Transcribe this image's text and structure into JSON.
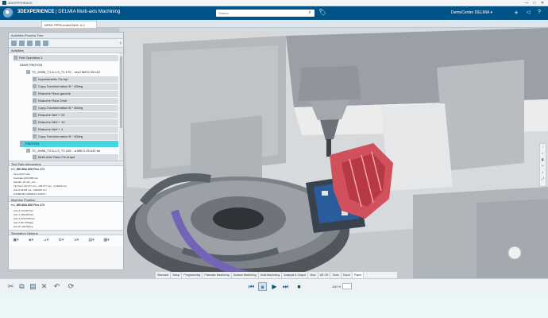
{
  "os_bar": {
    "title": "3DEXPERIENCE",
    "minimize": "—",
    "maximize": "□",
    "close": "✕"
  },
  "header": {
    "brand_bold": "3DEXPERIENCE",
    "brand_rest": " | DELMIA  Multi-axis Machining",
    "search_placeholder": "Search",
    "user": "DemoCenter DELMIA ▾",
    "icons": [
      "plus-icon",
      "share-icon",
      "share-icon",
      "help-icon"
    ]
  },
  "tabs": {
    "active": "NPKE PPRContext Ishb .A.1"
  },
  "panel": {
    "title": "Activities Process Tree",
    "tree_header": "Activities",
    "rows": [
      {
        "label": "Part Operation.1",
        "kind": "op"
      },
      {
        "label": "DEMI FINITION",
        "kind": "plain"
      },
      {
        "label": "TC_KMW_T1 A-1 0_T1 170... mod Mill D 25 b10",
        "kind": "plain"
      },
      {
        "label": "Isoparametric Fin top",
        "kind": "op"
      },
      {
        "label": "Copy-Transformation B * 40deg",
        "kind": "op"
      },
      {
        "label": "Ebauche Flanc gauche",
        "kind": "op"
      },
      {
        "label": "Ebauche Flanc Droit",
        "kind": "op"
      },
      {
        "label": "Copy-Transformation B * 40deg",
        "kind": "op"
      },
      {
        "label": "Ebauche Nerf + 20",
        "kind": "op"
      },
      {
        "label": "Ebauche Nerf + 10",
        "kind": "op"
      },
      {
        "label": "Ebauche Nerf + 1",
        "kind": "op"
      },
      {
        "label": "Copy-Transformation B * 40deg",
        "kind": "op"
      },
      {
        "label": "FINITION",
        "kind": "sel"
      },
      {
        "label": "TC_KMW_T2 A-1 0_T2 169... a Mill D 25 b10 fm",
        "kind": "plain"
      },
      {
        "label": "Multi-Axis Flank Fin drapé",
        "kind": "op"
      }
    ],
    "tool_path_title": "Tool Path Information",
    "tool_path_name": "▾ 1_DELMIA 8X8 Flex 173",
    "tool_path_lines": [
      "Time  00:07:21s",
      "Feedrate  1000.000 mm",
      "Spindle  -20 turn_mm",
      "Tip Point  -20.277 mm, -105.277 mm, -9.29322 mm",
      "Axis  0.04345 ma, -0.80345 mm",
      "  0.0085396 0.980403 0.128727"
    ],
    "machine_title": "Machine Position",
    "machine_name": "▾ 1_DELMIA 8X8 Flex 173",
    "machine_lines": [
      "Axis Z  372.967mm",
      "Axis Y  182.814mm",
      "Axis X  379.8706mm",
      "Axis A  90.7079deg",
      "Axis B  -320.91deg"
    ],
    "sim_title": "Simulation Options",
    "sim_icons": [
      "video-icon",
      "layers-icon",
      "filter-icon",
      "settings-icon",
      "measure-icon",
      "grid-icon",
      "display-icon"
    ]
  },
  "workbench_tabs": [
    "Standard",
    "Setup",
    "Programming",
    "Prismatic Machining",
    "Surface Machining",
    "Axial Machining",
    "Analysis & Output",
    "View",
    "AR-VR",
    "Tools",
    "Touch",
    "Paper"
  ],
  "workbench_active": "Paper",
  "actions": {
    "playback": [
      "⏮",
      "⏸",
      "▶",
      "⏭",
      "⏹"
    ],
    "speed_label": "100 %"
  },
  "colors": {
    "brand": "#005386",
    "selection": "#45d4e2",
    "part": "#d0505c"
  }
}
